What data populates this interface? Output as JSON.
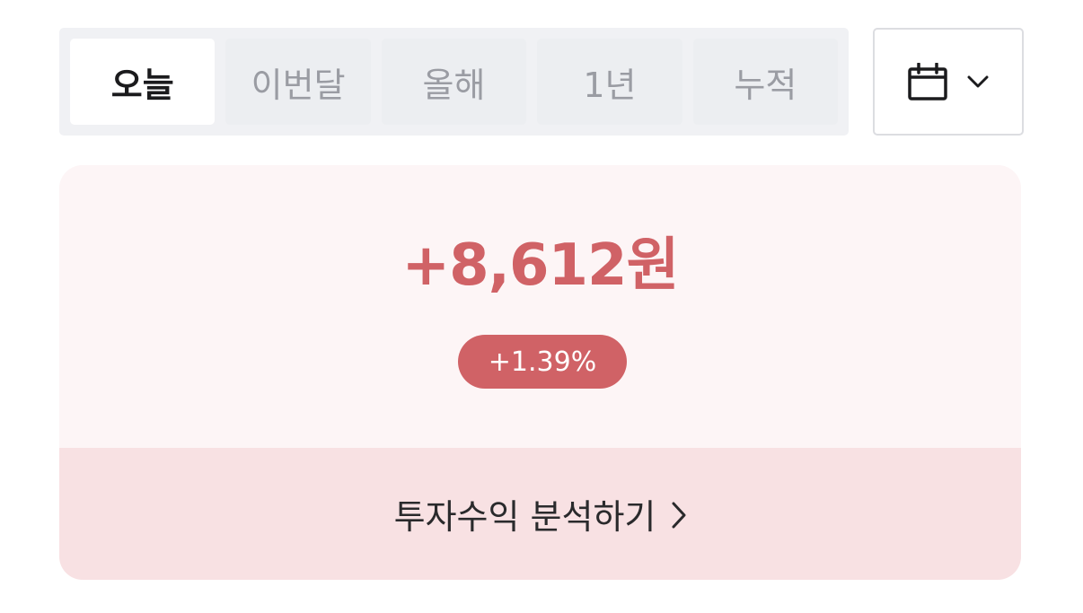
{
  "period_tabs": [
    {
      "label": "오늘",
      "active": true
    },
    {
      "label": "이번달",
      "active": false
    },
    {
      "label": "올해",
      "active": false
    },
    {
      "label": "1년",
      "active": false
    },
    {
      "label": "누적",
      "active": false
    }
  ],
  "date_picker": {
    "icon": "calendar-icon",
    "dropdown_icon": "chevron-down-icon"
  },
  "summary": {
    "profit_amount": "+8,612원",
    "profit_rate": "+1.39%",
    "analyze_link_label": "투자수익 분석하기",
    "analyze_link_icon": "chevron-right-icon"
  },
  "colors": {
    "profit_red": "#d06266",
    "card_bg": "#fdf5f6",
    "link_bg": "#f8e1e3",
    "tab_bg": "#f0f1f4"
  }
}
